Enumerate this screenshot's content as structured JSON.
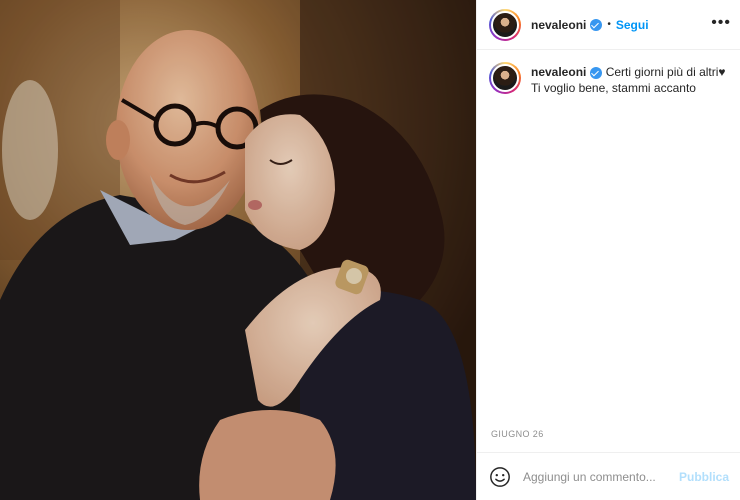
{
  "post": {
    "photo_alt": "",
    "date": "GIUGNO 26"
  },
  "header": {
    "username": "nevaleoni",
    "separator": "•",
    "follow_label": "Segui",
    "more_icon": "more-horizontal-icon",
    "more_glyph": "•••"
  },
  "caption": {
    "username": "nevaleoni",
    "line1": "Certi giorni più di altri♥",
    "line2": "Ti voglio bene, stammi accanto"
  },
  "comment": {
    "placeholder": "Aggiungi un commento...",
    "value": "",
    "publish_label": "Pubblica",
    "emoji_icon": "smiley-icon"
  },
  "colors": {
    "accent": "#0095f6",
    "verified": "#3897f0",
    "publish_disabled": "#b2dffc",
    "muted": "#8e8e8e"
  }
}
